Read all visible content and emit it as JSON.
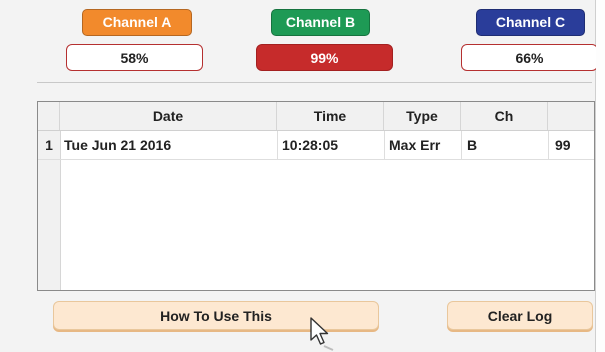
{
  "channels": [
    {
      "label": "Channel A",
      "value": "58%",
      "color": "#f28a2c",
      "alarm": false
    },
    {
      "label": "Channel B",
      "value": "99%",
      "color": "#1e9a55",
      "alarm": true
    },
    {
      "label": "Channel C",
      "value": "66%",
      "color": "#2a3d9a",
      "alarm": false
    }
  ],
  "colors": {
    "alarm_fill": "#c62b2b",
    "alarm_text": "#ffffff",
    "normal_border": "#b53030",
    "button_fill": "#fde8d1"
  },
  "log": {
    "columns": [
      "Date",
      "Time",
      "Type",
      "Ch"
    ],
    "rows": [
      {
        "index": "1",
        "date": "Tue Jun 21 2016",
        "time": "10:28:05",
        "type": "Max Err",
        "ch": "B",
        "value": "99"
      }
    ]
  },
  "buttons": {
    "how_to": "How To Use This",
    "clear": "Clear Log"
  },
  "icons": {
    "cursor": "mouse-pointer-icon"
  }
}
